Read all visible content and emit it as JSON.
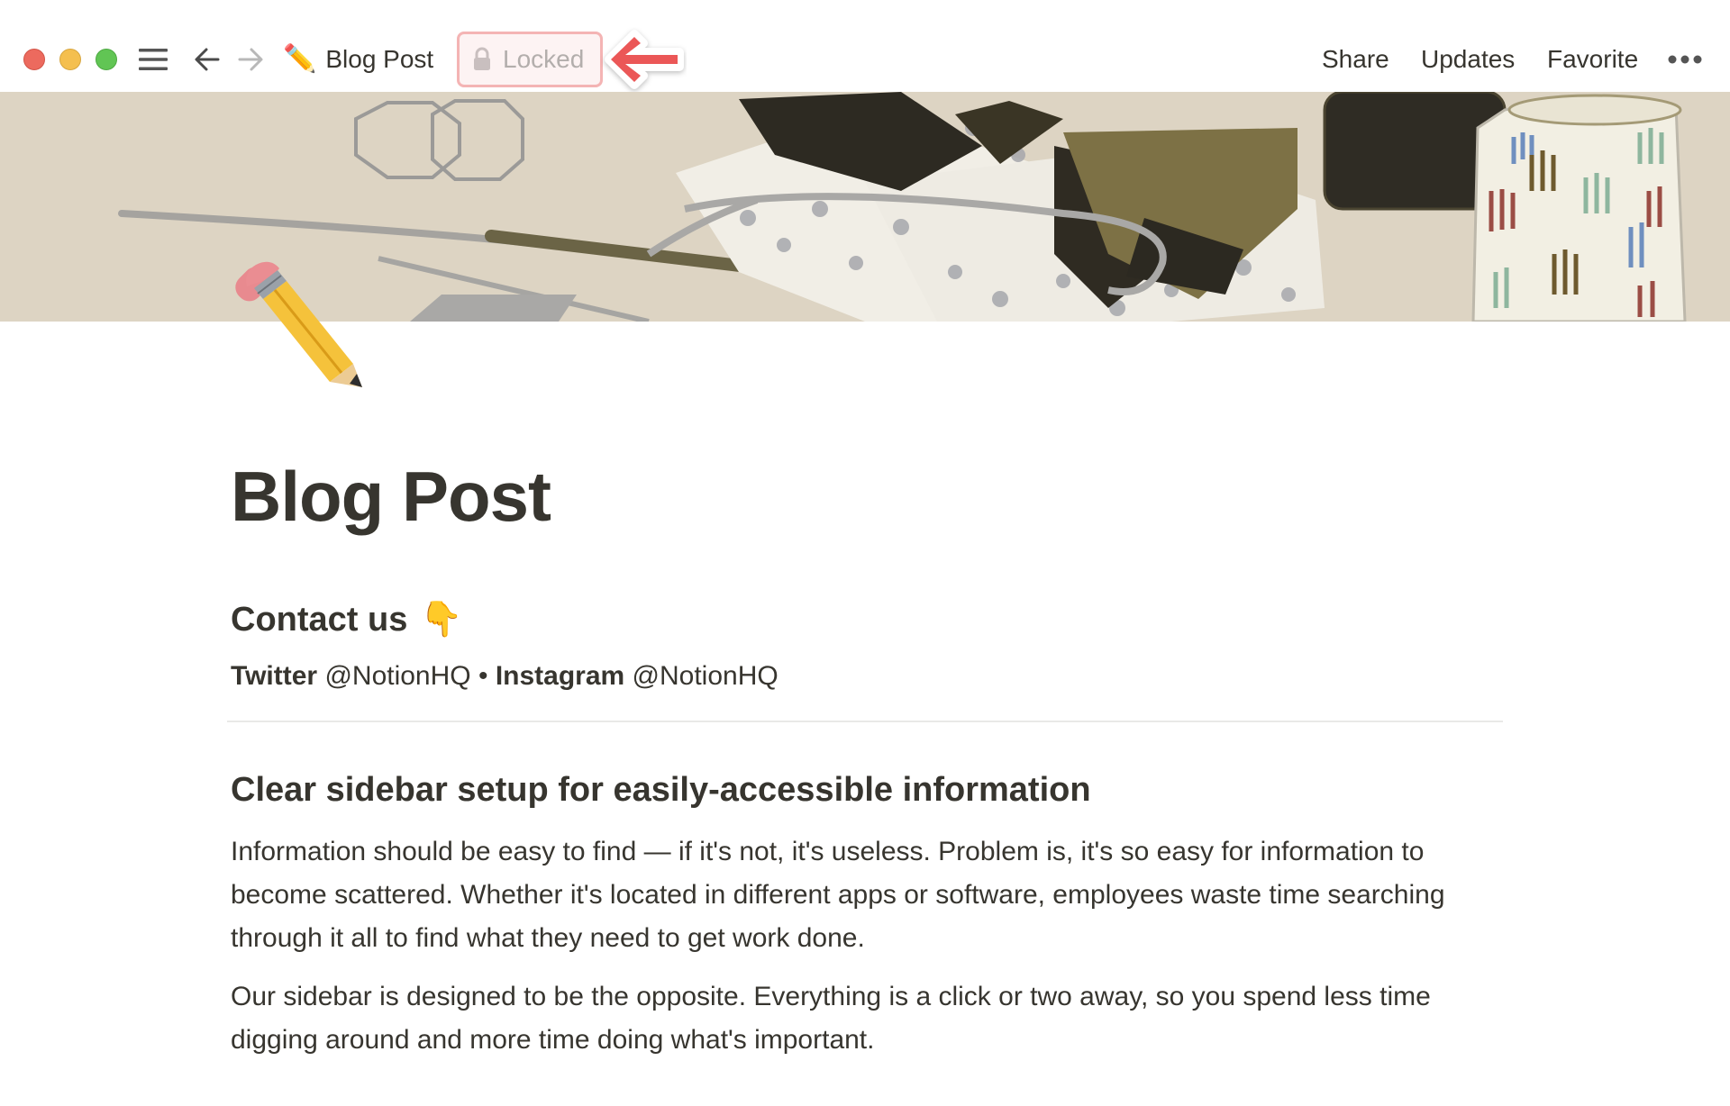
{
  "window": {
    "controls": [
      "close",
      "minimize",
      "maximize"
    ]
  },
  "topbar": {
    "breadcrumb": {
      "icon": "✏️",
      "title": "Blog Post"
    },
    "locked_label": "Locked",
    "actions": {
      "share": "Share",
      "updates": "Updates",
      "favorite": "Favorite",
      "more": "•••"
    },
    "annotation_color": "#eb5757"
  },
  "page": {
    "icon": "✏️",
    "title": "Blog Post",
    "contact": {
      "heading": "Contact us",
      "heading_emoji": "👇",
      "twitter_label": "Twitter",
      "twitter_handle": " @NotionHQ",
      "separator": " • ",
      "instagram_label": "Instagram",
      "instagram_handle": " @NotionHQ"
    },
    "section": {
      "heading": "Clear sidebar setup for easily-accessible information",
      "paragraphs": [
        "Information should be easy to find — if it's not, it's useless. Problem is, it's so easy for information to become scattered. Whether it's located in different apps or software, employees waste time searching through it all to find what they need to get work done.",
        "Our sidebar is designed to be the opposite. Everything is a click or two away, so you spend less time digging around and more time doing what's important."
      ]
    }
  }
}
